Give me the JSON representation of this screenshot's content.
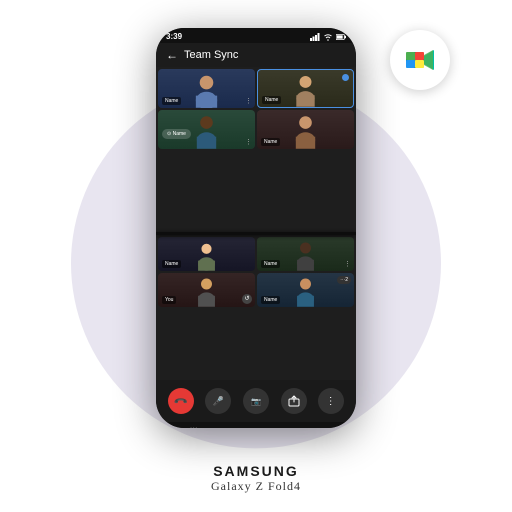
{
  "scene": {
    "bg_circle_color": "#e8e5f0"
  },
  "phone": {
    "status_bar": {
      "time": "3:39",
      "signal_icon": "signal",
      "wifi_icon": "wifi",
      "battery_icon": "battery"
    },
    "header": {
      "back_label": "←",
      "title": "Team Sync"
    },
    "participants": [
      {
        "id": 1,
        "name": "Name",
        "bg": "face-1",
        "cell_bg": "cell-bg-1"
      },
      {
        "id": 2,
        "name": "Name",
        "bg": "face-2",
        "cell_bg": "cell-bg-2"
      },
      {
        "id": 3,
        "name": "Name",
        "bg": "face-3",
        "cell_bg": "cell-bg-3"
      },
      {
        "id": 4,
        "name": "Name",
        "bg": "face-4",
        "cell_bg": "cell-bg-4"
      },
      {
        "id": 5,
        "name": "Name",
        "bg": "face-5",
        "cell_bg": "cell-bg-5"
      },
      {
        "id": 6,
        "name": "Name",
        "bg": "face-6",
        "cell_bg": "cell-bg-6"
      },
      {
        "id": 7,
        "name": "You",
        "bg": "face-7",
        "cell_bg": "cell-bg-7"
      },
      {
        "id": 8,
        "name": "Name",
        "bg": "face-8",
        "cell_bg": "cell-bg-8"
      }
    ],
    "controls": [
      {
        "id": "end-call",
        "type": "red",
        "icon": "📞"
      },
      {
        "id": "mute",
        "type": "dark",
        "icon": "🎤"
      },
      {
        "id": "camera",
        "type": "dark",
        "icon": "📷"
      },
      {
        "id": "share",
        "type": "dark",
        "icon": "↑"
      },
      {
        "id": "more",
        "type": "dark",
        "icon": "⋮"
      }
    ],
    "nav": [
      "|||",
      "○",
      "‹"
    ]
  },
  "samsung_label": {
    "brand": "SAMSUNG",
    "model": "Galaxy Z Fold4"
  },
  "meet_icon": {
    "alt": "Google Meet"
  }
}
